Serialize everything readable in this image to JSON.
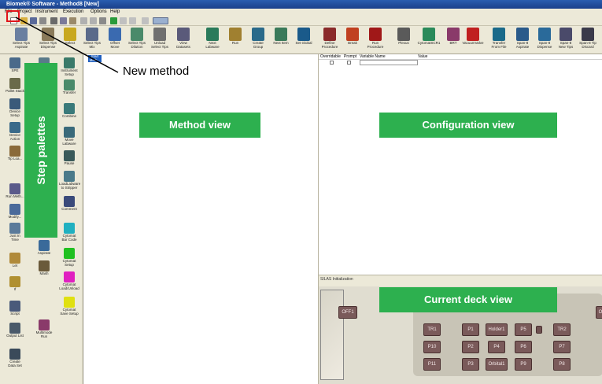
{
  "titlebar": {
    "text": "Biomek® Software - Method8 [New]"
  },
  "menu": [
    "File",
    "Project",
    "Instrument",
    "Execution",
    "Options",
    "Help"
  ],
  "ribbon": [
    {
      "label": "Select Tips\nAspirate",
      "color": "#6a7fa0",
      "icon": "tips-aspirate-icon"
    },
    {
      "label": "Select Tips\nDispense",
      "color": "#8a7a5a",
      "icon": "tips-dispense-icon"
    },
    {
      "label": "Select",
      "color": "#c8a820",
      "icon": "select-icon"
    },
    {
      "label": "Select Tips\nMix",
      "color": "#5a6a8a",
      "icon": "mix-icon"
    },
    {
      "label": "Offset\nMove",
      "color": "#3a6ab0",
      "icon": "move-icon"
    },
    {
      "label": "Select Tips\nDilution",
      "color": "#4a8a6a",
      "icon": "dilution-icon"
    },
    {
      "label": "Unload\nSelect Tips",
      "color": "#707070",
      "icon": "unload-icon"
    },
    {
      "label": "View\nDatasets",
      "color": "#5a5a7a",
      "icon": "datasets-icon"
    },
    {
      "label": "Next\nLabware",
      "color": "#2a7a5a",
      "icon": "labware-icon"
    },
    {
      "label": "Run",
      "color": "#a08030",
      "icon": "run-icon"
    },
    {
      "label": "Create\nGroup",
      "color": "#2a6a8a",
      "icon": "group-icon"
    },
    {
      "label": "Next Item",
      "color": "#3a7a5a",
      "icon": "next-item-icon"
    },
    {
      "label": "Set Global",
      "color": "#1a5a8a",
      "icon": "global-icon"
    },
    {
      "label": "Define\nProcedure",
      "color": "#8a2a2a",
      "icon": "define-icon"
    },
    {
      "label": "Break",
      "color": "#c04020",
      "icon": "break-icon"
    },
    {
      "label": "Run\nProcedure",
      "color": "#a01818",
      "icon": "run-procedure-icon"
    },
    {
      "label": "Plexus",
      "color": "#5a5a5a",
      "icon": "plexus-icon"
    },
    {
      "label": "CytomatSCR1",
      "color": "#2a8a5a",
      "icon": "cytomat-icon"
    },
    {
      "label": "BRT",
      "color": "#8a3a6a",
      "icon": "brt-icon"
    },
    {
      "label": "VacuumValve",
      "color": "#c02020",
      "icon": "vacuum-icon"
    },
    {
      "label": "Transfer\nFrom File",
      "color": "#1a6a8a",
      "icon": "transfer-icon"
    },
    {
      "label": "Span-8\nAspirate",
      "color": "#2a5a8a",
      "icon": "span-aspirate-icon"
    },
    {
      "label": "Span-8\nDispense",
      "color": "#2a6a9a",
      "icon": "span-dispense-icon"
    },
    {
      "label": "Span-8\nNew Tips",
      "color": "#4a4a6a",
      "icon": "span-tips-icon"
    },
    {
      "label": "Span-8 Tip\nDiscard",
      "color": "#3a3a4a",
      "icon": "span-discard-icon"
    }
  ],
  "palette_left": [
    {
      "label": "SPE",
      "color": "#4a6a8a"
    },
    {
      "label": "Pallet Stack",
      "color": "#6a6a4a"
    },
    {
      "label": "Device\nSetup",
      "color": "#3a5a7a"
    },
    {
      "label": "Device\nAction",
      "color": "#3a6a8a"
    },
    {
      "label": "Tip Loa...",
      "color": "#8a6a3a"
    },
    {
      "label": "Run Meth...",
      "color": "#5a5a8a"
    },
    {
      "label": "Modify...",
      "color": "#4a6a9a"
    },
    {
      "label": "Just In\nTime",
      "color": "#5a7a9a"
    },
    {
      "label": "Let",
      "color": "#b08a3a"
    },
    {
      "label": "If",
      "color": "#b09030"
    },
    {
      "label": "Script",
      "color": "#4a5a7a"
    },
    {
      "label": "Output List",
      "color": "#4a5a6a"
    },
    {
      "label": "Create\nData Set",
      "color": "#3a4a5a"
    }
  ],
  "palette_mid": [
    {
      "label": "",
      "color": "#5a7a8a"
    },
    {
      "label": "Aspirate",
      "color": "#3a6a9a"
    },
    {
      "label": "Mash",
      "color": "#6a5a3a"
    },
    {
      "label": "Multimode\nRun",
      "color": "#8a3a6a"
    }
  ],
  "palette_right": [
    {
      "label": "Instrument\nSetup",
      "color": "#3a7a6a"
    },
    {
      "label": "Transfer",
      "color": "#4a8a6a"
    },
    {
      "label": "Combine",
      "color": "#3a7a7a"
    },
    {
      "label": "Move\nLabware",
      "color": "#3a6a7a"
    },
    {
      "label": "Pause",
      "color": "#3a5a5a"
    },
    {
      "label": "LoadLabware\nto Stripper",
      "color": "#4a7a8a"
    },
    {
      "label": "Comment",
      "color": "#3a4a7a"
    },
    {
      "label": "Cytomat\nBar Code",
      "color": "#20b0c0"
    },
    {
      "label": "Cytomat\nSetup",
      "color": "#20c020"
    },
    {
      "label": "Cytomat\nLoad/Unload",
      "color": "#e020c0"
    },
    {
      "label": "Cytomat\nSave Setup",
      "color": "#e0e010"
    }
  ],
  "method_view": {
    "start_label": "Start\nMeth..."
  },
  "config_view": {
    "headers": [
      "Overridable",
      "Prompt",
      "Variable Name",
      "Value"
    ]
  },
  "deck_view": {
    "header": "SILAS Initialization",
    "side_left": "OFF1",
    "side_right": "O",
    "positions": [
      "TR1",
      "P1",
      "Holder1",
      "P5",
      "TR2",
      "P10",
      "P2",
      "P4",
      "P6",
      "P7",
      "P11",
      "P3",
      "Orbital1",
      "P9",
      "P8"
    ]
  },
  "annotations": {
    "new_method": "New method",
    "method_view": "Method view",
    "configuration_view": "Configuration view",
    "current_deck_view": "Current deck view",
    "step_palettes": "Step palettes"
  }
}
